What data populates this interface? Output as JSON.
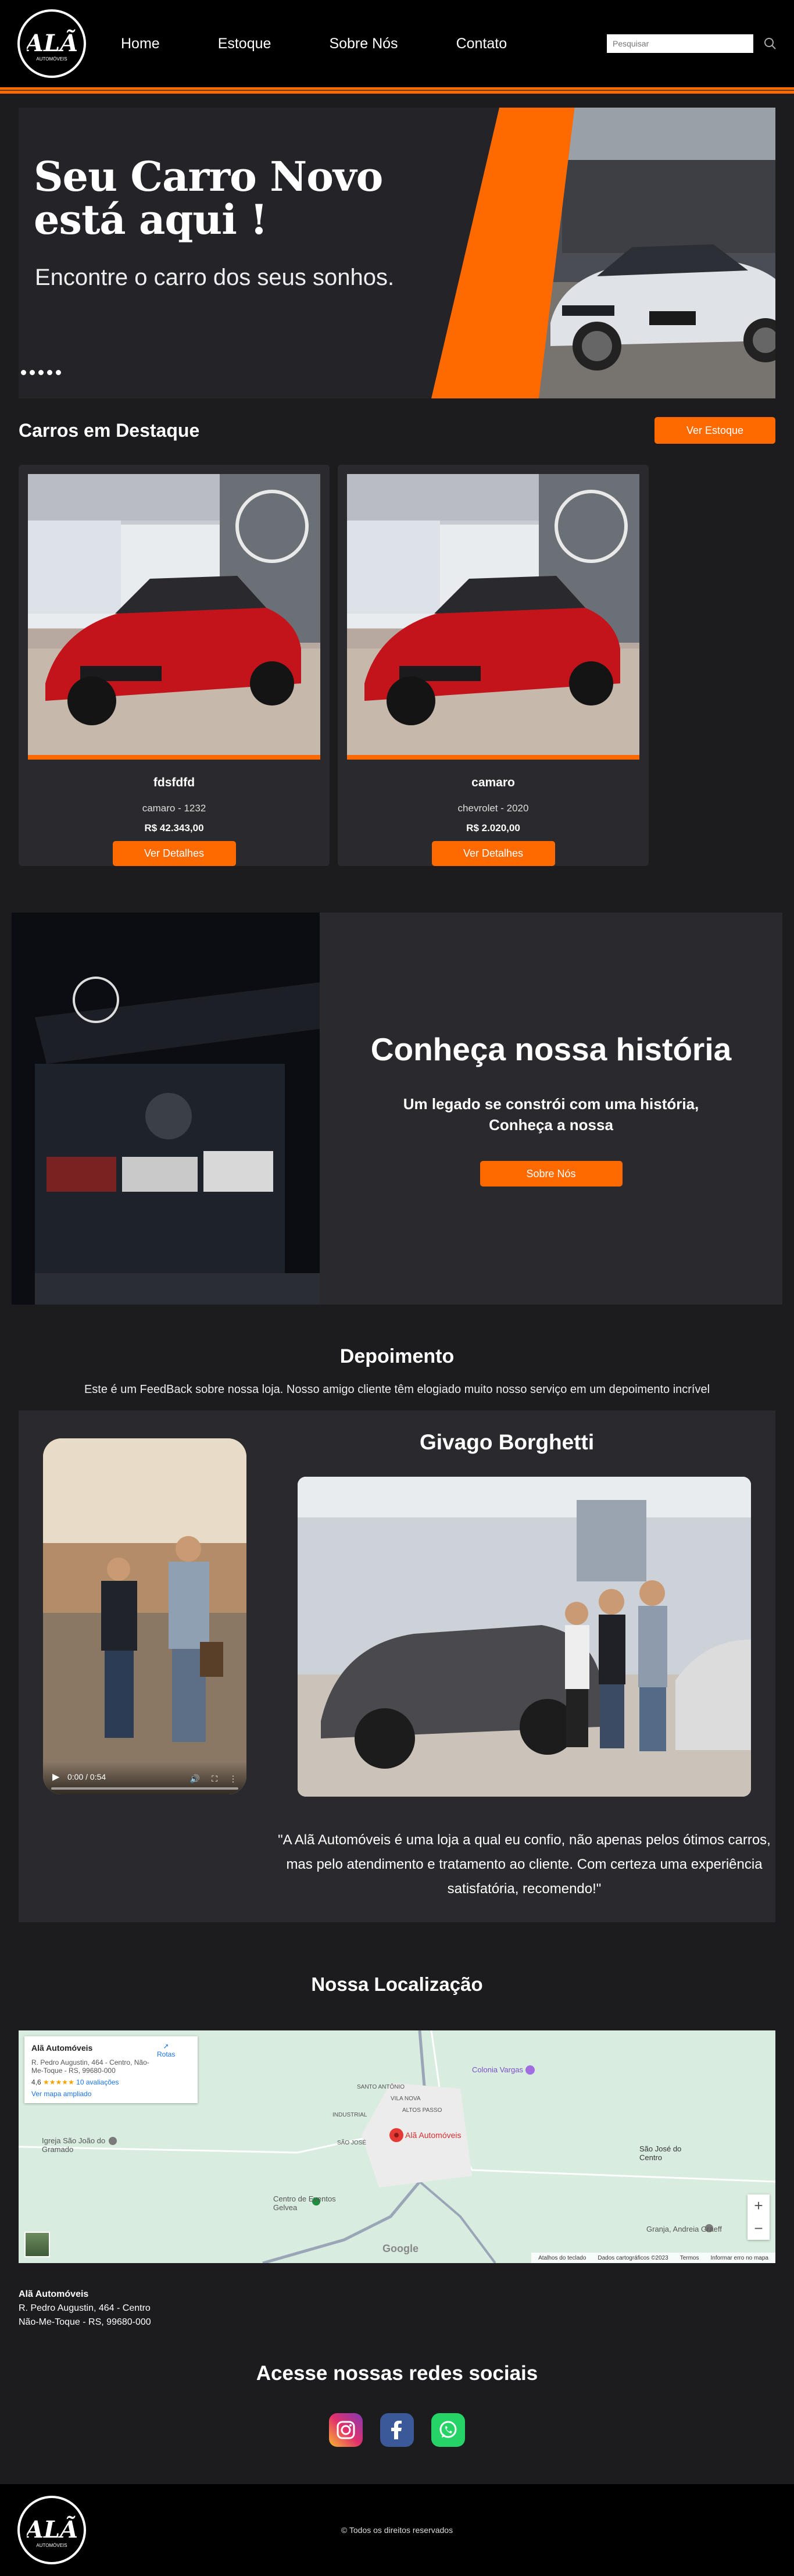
{
  "header": {
    "logo_text": "ALÃ",
    "logo_sub": "AUTOMÓVEIS",
    "nav": [
      "Home",
      "Estoque",
      "Sobre Nós",
      "Contato"
    ],
    "search_placeholder": "Pesquisar"
  },
  "hero": {
    "title_line1": "Seu Carro Novo",
    "title_line2": "está aqui !",
    "subtitle": "Encontre o carro dos seus sonhos."
  },
  "featured": {
    "title": "Carros em Destaque",
    "stock_button": "Ver Estoque",
    "cars": [
      {
        "name": "fdsfdfd",
        "model": "camaro - 1232",
        "price": "R$ 42.343,00",
        "button": "Ver Detalhes"
      },
      {
        "name": "camaro",
        "model": "chevrolet - 2020",
        "price": "R$ 2.020,00",
        "button": "Ver Detalhes"
      }
    ]
  },
  "history": {
    "title": "Conheça nossa história",
    "subtitle": "Um legado se constrói com uma história,\nConheça a nossa",
    "button": "Sobre Nós"
  },
  "testimony": {
    "title": "Depoimento",
    "intro": "Este é um FeedBack sobre nossa loja. Nosso amigo cliente têm elogiado muito nosso serviço em um depoimento incrível",
    "video_time": "0:00 / 0:54",
    "person": "Givago Borghetti",
    "quote": "\"A Alã Automóveis é uma loja a qual eu confio, não apenas pelos ótimos carros, mas pelo atendimento e tratamento ao cliente. Com certeza uma experiência satisfatória, recomendo!\""
  },
  "location": {
    "title": "Nossa Localização",
    "map": {
      "place": "Alã Automóveis",
      "address": "R. Pedro Augustin, 464 - Centro, Não-Me-Toque - RS, 99680-000",
      "rating": "4,6",
      "stars": "★★★★★",
      "reviews": "10 avaliações",
      "bigger_map": "Ver mapa ampliado",
      "route": "Rotas",
      "pin_label": "Alã Automóveis",
      "labels": [
        "Colonia Vargas",
        "Igreja São João do Gramado",
        "São José do Centro",
        "Centro de Eventos Gelvea",
        "Granja, Andreia Graeff",
        "SANTO ANTÔNIO",
        "INDUSTRIAL",
        "VILA NOVA",
        "ALTOS PASSO",
        "SÃO JOSÉ"
      ],
      "google": "Google",
      "footer": [
        "Atalhos do teclado",
        "Dados cartográficos ©2023",
        "Termos",
        "Informar erro no mapa"
      ]
    }
  },
  "address": {
    "name": "Alã Automóveis",
    "line1": "R. Pedro Augustin, 464 - Centro",
    "line2": "Não-Me-Toque - RS, 99680-000"
  },
  "social": {
    "title": "Acesse nossas redes sociais",
    "icons": [
      "instagram-icon",
      "facebook-icon",
      "whatsapp-icon"
    ]
  },
  "footer": {
    "copy": "© Todos os direitos reservados"
  },
  "colors": {
    "accent": "#ff6a00",
    "background": "#1c1c1f",
    "card": "#2a2a2e"
  }
}
